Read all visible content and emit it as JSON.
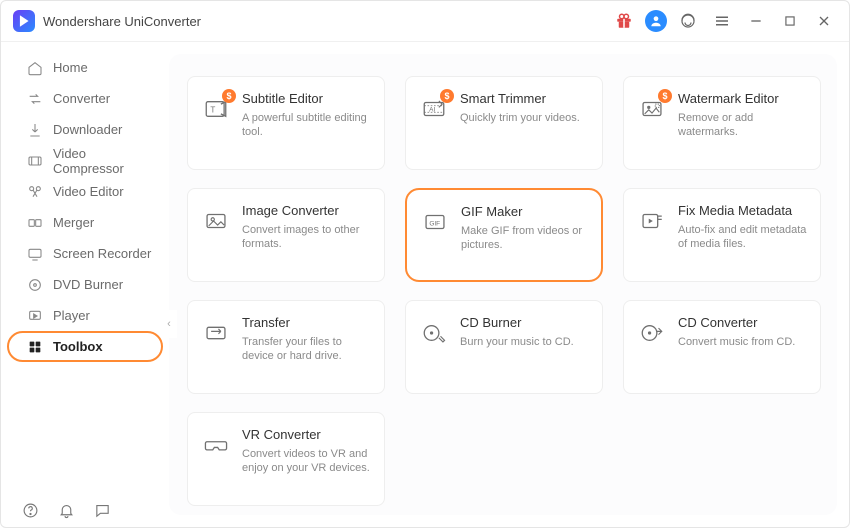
{
  "app": {
    "title": "Wondershare UniConverter"
  },
  "titlebar_icons": {
    "gift": "gift-icon",
    "account": "account-icon",
    "support": "support-icon",
    "menu": "hamburger-icon",
    "minimize": "minimize-icon",
    "maximize": "maximize-icon",
    "close": "close-icon"
  },
  "sidebar": {
    "collapse_glyph": "‹",
    "items": [
      {
        "id": "home",
        "label": "Home",
        "active": false
      },
      {
        "id": "converter",
        "label": "Converter",
        "active": false
      },
      {
        "id": "downloader",
        "label": "Downloader",
        "active": false
      },
      {
        "id": "video-compressor",
        "label": "Video Compressor",
        "active": false
      },
      {
        "id": "video-editor",
        "label": "Video Editor",
        "active": false
      },
      {
        "id": "merger",
        "label": "Merger",
        "active": false
      },
      {
        "id": "screen-recorder",
        "label": "Screen Recorder",
        "active": false
      },
      {
        "id": "dvd-burner",
        "label": "DVD Burner",
        "active": false
      },
      {
        "id": "player",
        "label": "Player",
        "active": false
      },
      {
        "id": "toolbox",
        "label": "Toolbox",
        "active": true
      }
    ],
    "bottom": {
      "help": "help-icon",
      "notifications": "bell-icon",
      "feedback": "comment-icon"
    }
  },
  "tools": [
    {
      "id": "subtitle-editor",
      "title": "Subtitle Editor",
      "desc": "A powerful subtitle editing tool.",
      "badge": "$",
      "highlight": false
    },
    {
      "id": "smart-trimmer",
      "title": "Smart Trimmer",
      "desc": "Quickly trim your videos.",
      "badge": "$",
      "highlight": false
    },
    {
      "id": "watermark-editor",
      "title": "Watermark Editor",
      "desc": "Remove or add watermarks.",
      "badge": "$",
      "highlight": false
    },
    {
      "id": "image-converter",
      "title": "Image Converter",
      "desc": "Convert images to other formats.",
      "badge": null,
      "highlight": false
    },
    {
      "id": "gif-maker",
      "title": "GIF Maker",
      "desc": "Make GIF from videos or pictures.",
      "badge": null,
      "highlight": true
    },
    {
      "id": "fix-media-metadata",
      "title": "Fix Media Metadata",
      "desc": "Auto-fix and edit metadata of media files.",
      "badge": null,
      "highlight": false
    },
    {
      "id": "transfer",
      "title": "Transfer",
      "desc": "Transfer your files to device or hard drive.",
      "badge": null,
      "highlight": false
    },
    {
      "id": "cd-burner",
      "title": "CD Burner",
      "desc": "Burn your music to CD.",
      "badge": null,
      "highlight": false
    },
    {
      "id": "cd-converter",
      "title": "CD Converter",
      "desc": "Convert music from CD.",
      "badge": null,
      "highlight": false
    },
    {
      "id": "vr-converter",
      "title": "VR Converter",
      "desc": "Convert videos to VR and enjoy on your VR devices.",
      "badge": null,
      "highlight": false
    }
  ]
}
